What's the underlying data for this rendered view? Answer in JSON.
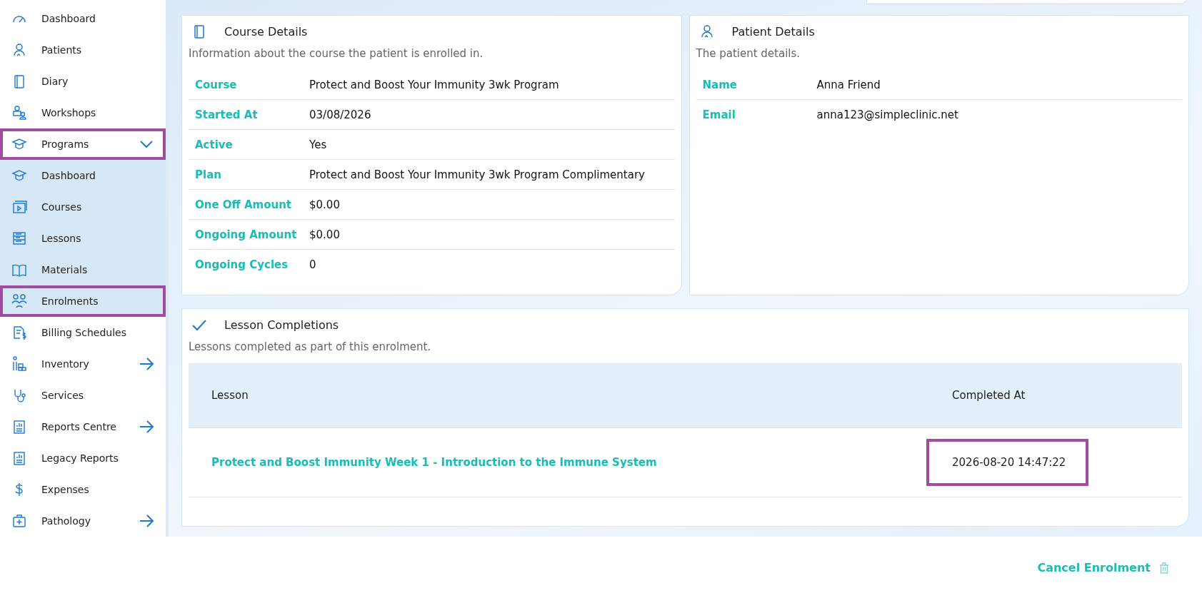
{
  "sidebar": {
    "items": [
      {
        "label": "Dashboard",
        "kind": "link",
        "highlighted": false
      },
      {
        "label": "Patients",
        "kind": "link",
        "highlighted": false
      },
      {
        "label": "Diary",
        "kind": "link",
        "highlighted": false
      },
      {
        "label": "Workshops",
        "kind": "link",
        "highlighted": false
      },
      {
        "label": "Programs",
        "kind": "group",
        "expanded": true,
        "highlighted": true,
        "children": [
          {
            "label": "Dashboard",
            "kind": "link",
            "highlighted": false
          },
          {
            "label": "Courses",
            "kind": "link",
            "highlighted": false
          },
          {
            "label": "Lessons",
            "kind": "link",
            "highlighted": false
          },
          {
            "label": "Materials",
            "kind": "link",
            "highlighted": false
          },
          {
            "label": "Enrolments",
            "kind": "link",
            "highlighted": true
          }
        ]
      },
      {
        "label": "Billing Schedules",
        "kind": "link",
        "highlighted": false
      },
      {
        "label": "Inventory",
        "kind": "flyout",
        "highlighted": false
      },
      {
        "label": "Services",
        "kind": "link",
        "highlighted": false
      },
      {
        "label": "Reports Centre",
        "kind": "flyout",
        "highlighted": false
      },
      {
        "label": "Legacy Reports",
        "kind": "link",
        "highlighted": false
      },
      {
        "label": "Expenses",
        "kind": "link",
        "highlighted": false
      },
      {
        "label": "Pathology",
        "kind": "flyout",
        "highlighted": false
      }
    ]
  },
  "course_details": {
    "title": "Course Details",
    "description": "Information about the course the patient is enrolled in.",
    "rows": [
      {
        "label": "Course",
        "value": "Protect and Boost Your Immunity 3wk Program"
      },
      {
        "label": "Started At",
        "value": "03/08/2026"
      },
      {
        "label": "Active",
        "value": "Yes"
      },
      {
        "label": "Plan",
        "value": "Protect and Boost Your Immunity 3wk Program Complimentary"
      },
      {
        "label": "One Off Amount",
        "value": "$0.00"
      },
      {
        "label": "Ongoing Amount",
        "value": "$0.00"
      },
      {
        "label": "Ongoing Cycles",
        "value": "0"
      }
    ]
  },
  "patient_details": {
    "title": "Patient Details",
    "description": "The patient details.",
    "rows": [
      {
        "label": "Name",
        "value": "Anna Friend"
      },
      {
        "label": "Email",
        "value": "anna123@simpleclinic.net"
      }
    ]
  },
  "lesson_completions": {
    "title": "Lesson Completions",
    "description": "Lessons completed as part of this enrolment.",
    "columns": [
      "Lesson",
      "Completed At"
    ],
    "rows": [
      {
        "lesson": "Protect and Boost Immunity Week 1 - Introduction to the Immune System",
        "completed_at": "2026-08-20 14:47:22",
        "highlighted": true
      }
    ]
  },
  "cancel_enrolment": {
    "label": "Cancel Enrolment"
  }
}
